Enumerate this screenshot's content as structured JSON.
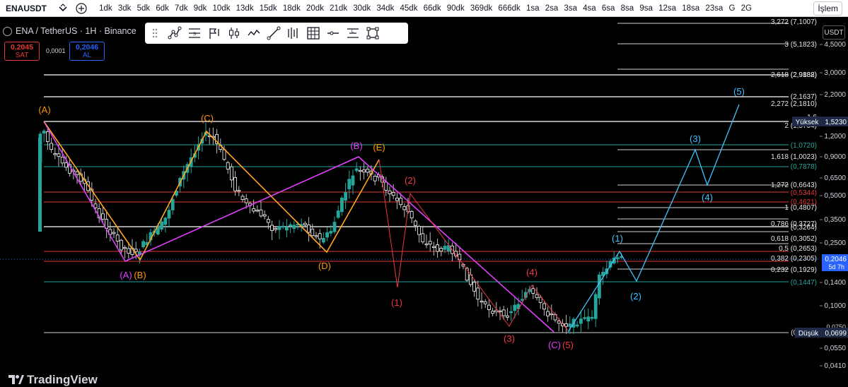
{
  "topbar": {
    "symbol": "ENAUSDT",
    "intervals": [
      "1dk",
      "3dk",
      "5dk",
      "6dk",
      "7dk",
      "9dk",
      "10dk",
      "13dk",
      "15dk",
      "18dk",
      "20dk",
      "21dk",
      "30dk",
      "34dk",
      "45dk",
      "66dk",
      "90dk",
      "369dk",
      "666dk",
      "1sa",
      "2sa",
      "3sa",
      "4sa",
      "6sa",
      "8sa",
      "9sa",
      "12sa",
      "18sa",
      "23sa",
      "G",
      "2G"
    ],
    "trade_button": "İşlem"
  },
  "legend": {
    "title": "ENA / TetherUS · 1H · Binance"
  },
  "orderbox": {
    "sell_price": "0,2045",
    "sell_label": "SAT",
    "spread": "0,0001",
    "buy_price": "0,2046",
    "buy_label": "AL"
  },
  "drawing_toolbar": {
    "icons": [
      "drag-handle-icon",
      "pattern-tool-icon",
      "settings-tool-icon",
      "flag-tool-icon",
      "candle-tool-icon",
      "line-style-icon",
      "trend-line-icon",
      "bars-pattern-icon",
      "grid-tool-icon",
      "horizontal-line-icon",
      "text-tool-icon",
      "rectangle-tool-icon"
    ]
  },
  "price_axis": {
    "currency": "USDT",
    "ticks": [
      "4,5000",
      "3,0000",
      "2,2000",
      "1,2000",
      "0,9000",
      "0,6500",
      "0,5000",
      "0,3500",
      "0,2500",
      "0,1400",
      "0,1000",
      "0,0550",
      "0,0410"
    ],
    "current_price": "0,2046",
    "countdown": "5d 7h",
    "high_label": "Yüksek",
    "high_value": "1,5230",
    "low_label": "Düşük",
    "low_value": "0,0699",
    "partial_tick": "0,0750",
    "colors": {
      "current": "#2962ff",
      "high_low": "#1e2a45"
    }
  },
  "fib_labels": [
    "3,272 (7,1007)",
    "3 (5,1823)",
    "2,618 (2,9882)",
    "(2,9188)",
    "(2,1637)",
    "2,272 (2,1810)",
    "1,6",
    "2 (1,5704)",
    "(1,0720)",
    "1,618 (1,0023)",
    "(0,7878)",
    "1,272 (0,6643)",
    "(0,5344)",
    "(0,4621)",
    "1 (0,4807)",
    "0,786 (0,3727)",
    "(0,3264)",
    "0,618 (0,3052)",
    "0,5 (0,2653)",
    "0,382 (0,2305)",
    "0,232 (0,1929)",
    "(0,1447)",
    "(0"
  ],
  "wave_labels": {
    "orange": [
      "(A)",
      "(B)",
      "(C)",
      "(D)",
      "(E)"
    ],
    "magenta": [
      "(A)",
      "(B)",
      "(C)"
    ],
    "red": [
      "(1)",
      "(2)",
      "(3)",
      "(4)",
      "(5)"
    ],
    "cyan": [
      "(1)",
      "(2)",
      "(3)",
      "(4)",
      "(5)"
    ]
  },
  "watermark": "TradingView"
}
